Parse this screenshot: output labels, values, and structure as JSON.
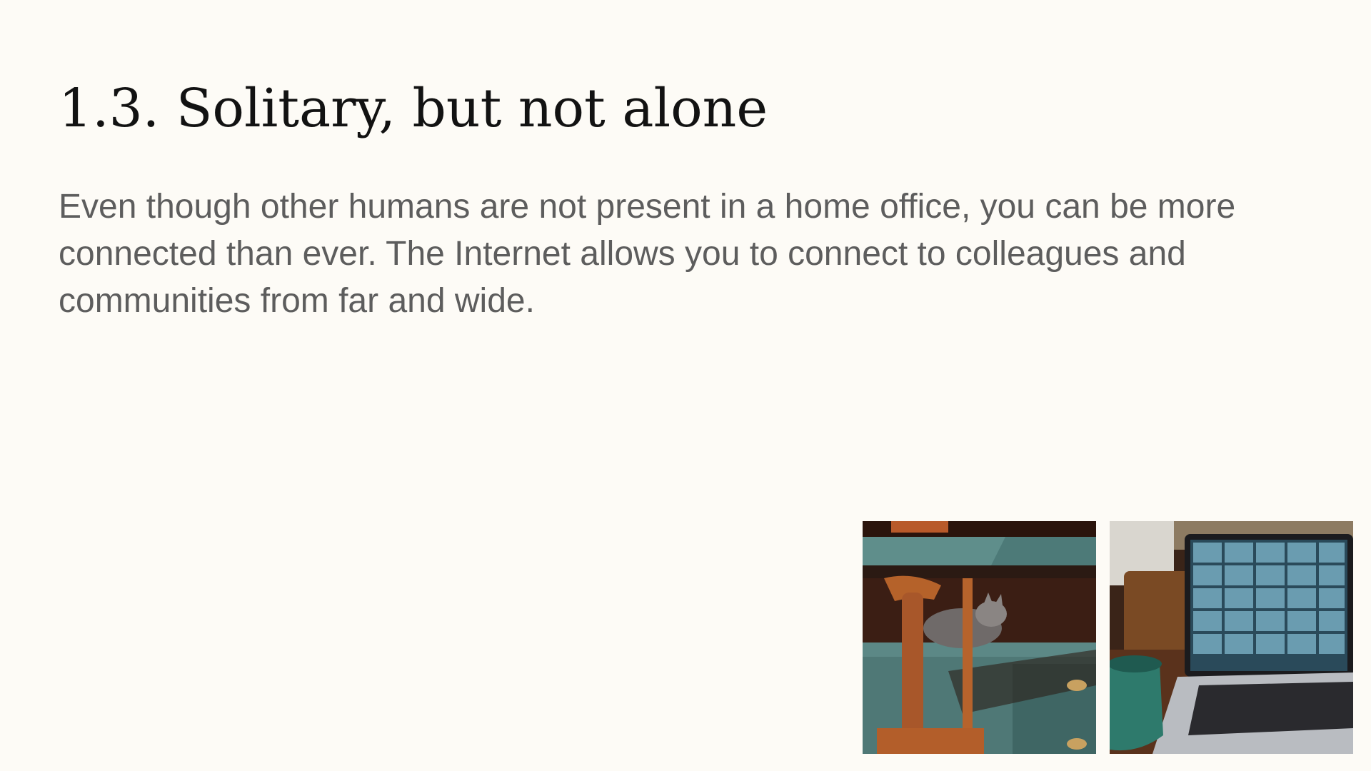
{
  "slide": {
    "title": "1.3. Solitary, but not alone",
    "body": "Even though other humans are not present in a home office, you can be more connected than ever. The Internet allows you to connect to colleagues and communities from far and wide."
  },
  "images": [
    {
      "name": "cat-on-desk-photo"
    },
    {
      "name": "video-call-laptop-photo"
    }
  ],
  "colors": {
    "background": "#fdfbf6",
    "title": "#121212",
    "body": "#5d5d5d"
  }
}
